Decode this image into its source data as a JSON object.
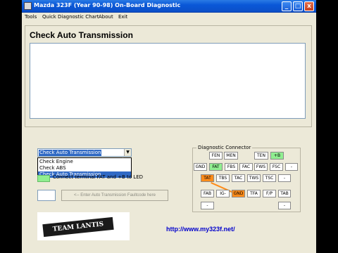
{
  "window": {
    "title": "Mazda 323F (Year 90-98) On-Board Diagnostic",
    "minimize": "_",
    "maximize": "□",
    "close": "x"
  },
  "menu": [
    "Tools",
    "Quick Diagnostic Chart",
    "About",
    "Exit"
  ],
  "main": {
    "page_title": "Check Auto Transmission",
    "result_text": ""
  },
  "mode_select": {
    "value": "Check Auto Transmission",
    "options": [
      "Check Engine",
      "Check ABS",
      "Check Auto Transmission"
    ],
    "selected_index": 2
  },
  "instruction": {
    "text": "Connect terminal FAT and +B to LED",
    "led_color": "#90ee90"
  },
  "faultcode": {
    "value": "",
    "button_label": "<-- Enter Auto Transmission Faultcode here"
  },
  "connector": {
    "title": "Diagnostic Connector",
    "pins": [
      {
        "label": "FEN",
        "state": "normal"
      },
      {
        "label": "MEN",
        "state": "normal"
      },
      {
        "label": "TEN",
        "state": "normal"
      },
      {
        "label": "+B",
        "state": "green"
      },
      {
        "label": "GND",
        "state": "normal"
      },
      {
        "label": "FAT",
        "state": "green"
      },
      {
        "label": "FBS",
        "state": "normal"
      },
      {
        "label": "FAC",
        "state": "normal"
      },
      {
        "label": "FWS",
        "state": "normal"
      },
      {
        "label": "FSC",
        "state": "normal"
      },
      {
        "label": "-",
        "state": "normal"
      },
      {
        "label": "TAT",
        "state": "orange"
      },
      {
        "label": "TBS",
        "state": "normal"
      },
      {
        "label": "TAC",
        "state": "normal"
      },
      {
        "label": "TWS",
        "state": "normal"
      },
      {
        "label": "TSC",
        "state": "normal"
      },
      {
        "label": "-",
        "state": "normal"
      },
      {
        "label": "FAB",
        "state": "normal"
      },
      {
        "label": "IG-",
        "state": "normal"
      },
      {
        "label": "GND",
        "state": "orange"
      },
      {
        "label": "TFA",
        "state": "normal"
      },
      {
        "label": "F/P",
        "state": "normal"
      },
      {
        "label": "TAB",
        "state": "normal"
      },
      {
        "label": "-",
        "state": "normal"
      },
      {
        "label": "-",
        "state": "normal"
      }
    ],
    "colors": {
      "green": "#90ee90",
      "orange": "#ff8c1a"
    }
  },
  "logo": {
    "text": "TEAM LANTIS"
  },
  "url": "http://www.my323f.net/"
}
